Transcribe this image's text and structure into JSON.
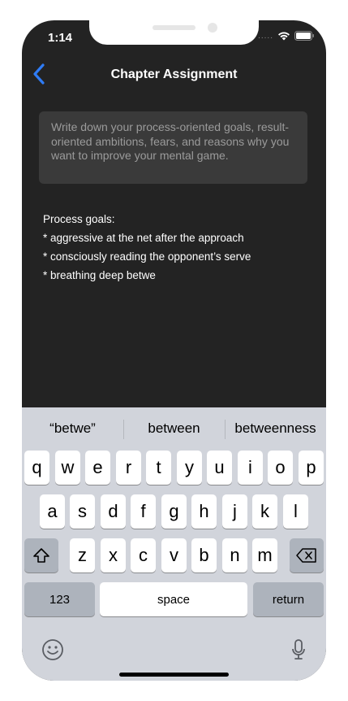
{
  "status": {
    "time": "1:14",
    "signal_dots": "....."
  },
  "nav": {
    "title": "Chapter Assignment"
  },
  "prompt": {
    "text": "Write down your process-oriented goals, result-oriented ambitions, fears, and reasons why you want to improve your mental game."
  },
  "answer": {
    "text": "Process goals:\n* aggressive at the net after the approach\n* consciously reading the opponent’s serve\n* breathing deep betwe"
  },
  "keyboard": {
    "suggestions": [
      "“betwe”",
      "between",
      "betweenness"
    ],
    "row1": [
      "q",
      "w",
      "e",
      "r",
      "t",
      "y",
      "u",
      "i",
      "o",
      "p"
    ],
    "row2": [
      "a",
      "s",
      "d",
      "f",
      "g",
      "h",
      "j",
      "k",
      "l"
    ],
    "row3": [
      "z",
      "x",
      "c",
      "v",
      "b",
      "n",
      "m"
    ],
    "numbers_label": "123",
    "space_label": "space",
    "return_label": "return"
  },
  "colors": {
    "background": "#232323",
    "accent": "#2f7cf6",
    "keyboard": "#d1d4db"
  }
}
